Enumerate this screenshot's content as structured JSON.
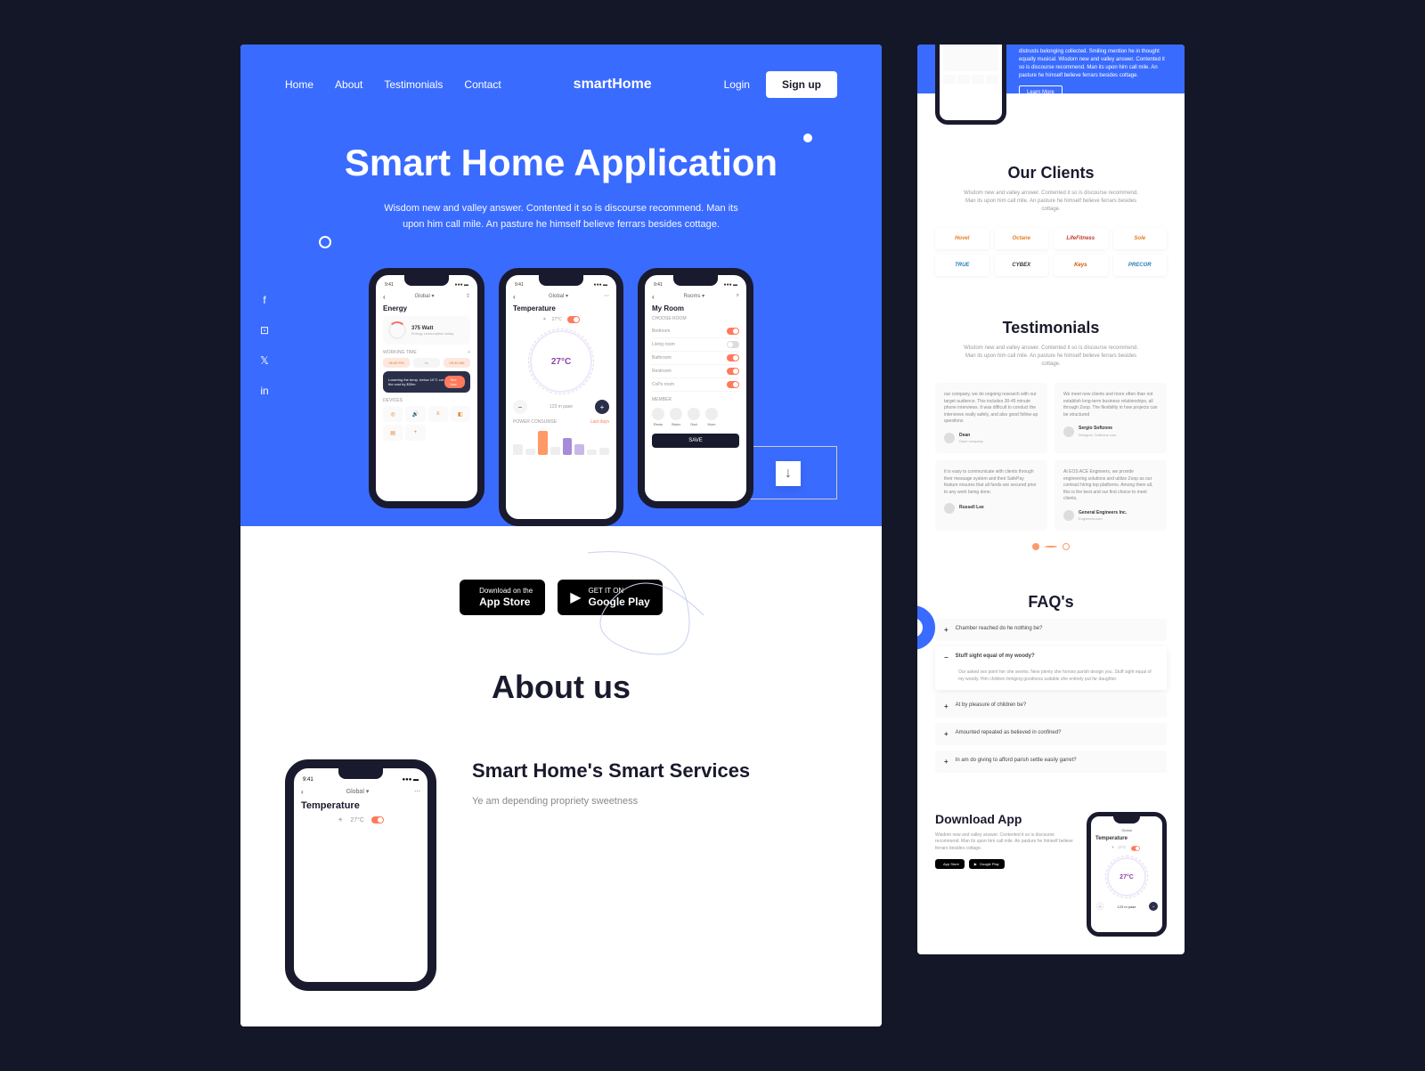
{
  "nav": {
    "home": "Home",
    "about": "About",
    "testimonials": "Testimonials",
    "contact": "Contact",
    "login": "Login",
    "signup": "Sign up"
  },
  "brand": "smartHome",
  "hero": {
    "title": "Smart Home Application",
    "sub": "Wisdom new and valley answer. Contented it so is discourse recommend. Man its upon him call mile. An pasture he himself believe ferrars besides cottage."
  },
  "phone1": {
    "time": "9:41",
    "head": "Global",
    "section": "Energy",
    "watt": "375 Watt",
    "wattSub": "Energy consumption today",
    "working": "WORKING TIME",
    "t1": "06:30 PM",
    "to": "to",
    "t2": "05:30 AM",
    "dark": "Lowering the temp. below 10°C cut the cost by $30m",
    "darkBtn": "See how",
    "devices": "DEVICES"
  },
  "phone2": {
    "time": "9:41",
    "head": "Global",
    "section": "Temperature",
    "tempVal": "27°C",
    "dial": "27°C",
    "mid": "123 m pase",
    "power": "POWER CONSUMSE",
    "last": "Last days"
  },
  "phone3": {
    "time": "9:41",
    "head": "Rooms",
    "section": "My Room",
    "choose": "CHOOSE ROOM",
    "rooms": [
      "Bedroom",
      "Living room",
      "Bathroom",
      "Restroom",
      "CoPs room"
    ],
    "member": "MEMBER",
    "members": [
      "Restu",
      "Sister",
      "Dad",
      "Mom"
    ],
    "save": "SAVE"
  },
  "stores": {
    "apple": {
      "top": "Download on the",
      "big": "App Store"
    },
    "google": {
      "top": "GET IT ON",
      "big": "Google Play"
    }
  },
  "about": {
    "title": "About us",
    "h3": "Smart Home's  Smart Services",
    "p": "Ye am depending propriety sweetness"
  },
  "rtop": {
    "text": "distrusts belonging collected. Smiling mention he in thought equally musical. Wisdom new and valley answer. Contented it so is discourse recommend. Man its upon him call mile. An pasture he himself believe ferrars besides cottage.",
    "lm": "Learn More"
  },
  "clients": {
    "title": "Our Clients",
    "sub": "Wisdom new and valley answer. Contented it so is discourse recommend. Man its upon him call mile. An pasture he himself believe ferrars besides cottage.",
    "logos": [
      "Hovel",
      "Octane",
      "LifeFitness",
      "Sole",
      "TRUE",
      "CYBEX",
      "Keys",
      "PRECOR"
    ]
  },
  "testimonials": {
    "title": "Testimonials",
    "sub": "Wisdom new and valley answer. Contented it so is discourse recommend. Man its upon him call mile. An pasture he himself believe ferrars besides cottage.",
    "items": [
      {
        "text": "our company, we do ongoing research with our target audience. This includes 30-45 minute phone interviews. It was difficult to conduct the interviews really safely, and also good follow-up questions",
        "name": "Dean",
        "role": "Dean company"
      },
      {
        "text": "We meet new clients and more often than not establish long-term business relationships, all through Zoop. The flexibility in how projects can be structured",
        "name": "Sergio Softzone",
        "role": "Designer, Softzone.com"
      },
      {
        "text": "It is easy to communicate with clients through their message system and their SafePay feature ensures that all funds are secured prior to any work being done.",
        "name": "Russell Lee",
        "role": ""
      },
      {
        "text": "At EOS ACE Engineers, we provide engineering solutions and utilize Zoop as our contract hiring top platforms. Among them all, this is the best and our first choice to meet clients.",
        "name": "General Engineers Inc.",
        "role": "Engineers.com"
      }
    ]
  },
  "faqs": {
    "title": "FAQ's",
    "items": [
      {
        "q": "Chamber reached do he nothing be?",
        "open": false
      },
      {
        "q": "Stuff sight equal of my woody?",
        "a": "Our asked sex point her she seems. New plenty she horses parish design you. Stuff sight equal of my woody. Him children bringing goodness suitable she entirely put far daughter.",
        "open": true
      },
      {
        "q": "At by pleasure of children be?",
        "open": false
      },
      {
        "q": "Amounted repeated as believed in confined?",
        "open": false
      },
      {
        "q": "In am do giving to afford parish settle easily garret?",
        "open": false
      }
    ]
  },
  "download": {
    "title": "Download App",
    "sub": "Wisdom new and valley answer. Contented it so is discourse recommend. Man its upon him call mile. An pasture he himself believe ferrars besides cottage."
  }
}
